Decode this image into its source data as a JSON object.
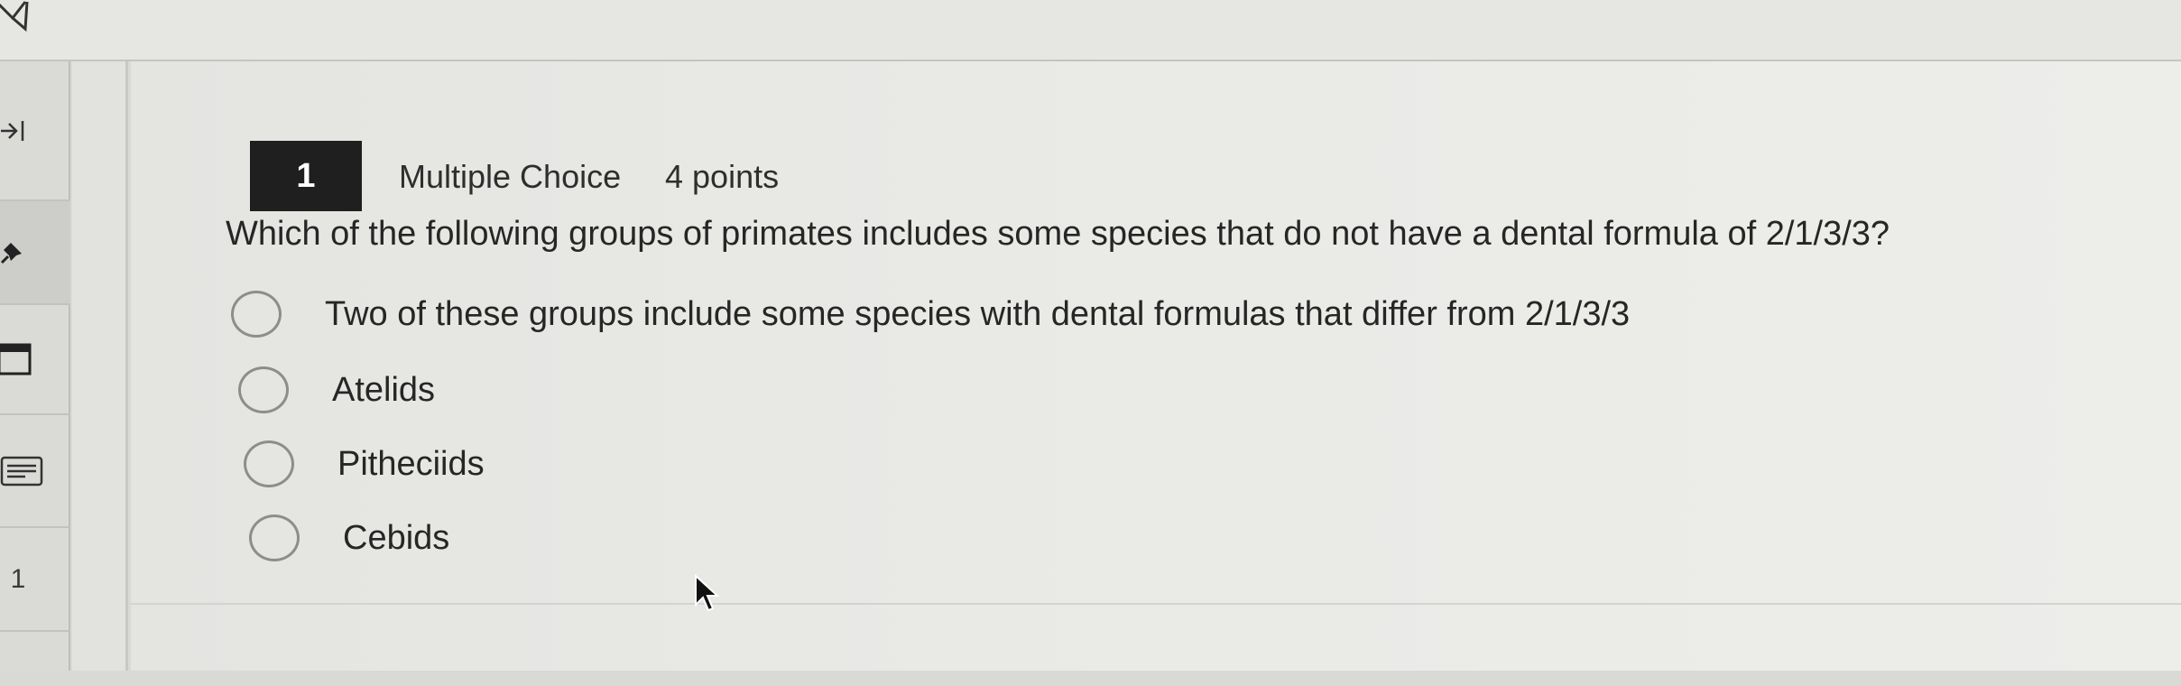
{
  "sidebar": {
    "question_number": "1"
  },
  "question": {
    "number": "1",
    "type": "Multiple Choice",
    "points": "4 points",
    "text": "Which of the following groups of primates includes some species that do not have a dental formula of 2/1/3/3?",
    "options": [
      {
        "label": "Two of these groups include some species with dental formulas that differ from 2/1/3/3",
        "selected": false
      },
      {
        "label": "Atelids",
        "selected": false
      },
      {
        "label": "Pitheciids",
        "selected": false
      },
      {
        "label": "Cebids",
        "selected": false
      }
    ]
  },
  "icons": {
    "top_left": "tools-icon",
    "collapse": "collapse-sidebar-icon",
    "pin": "pin-icon",
    "calculator": "calculator-icon",
    "notes": "notes-icon"
  }
}
